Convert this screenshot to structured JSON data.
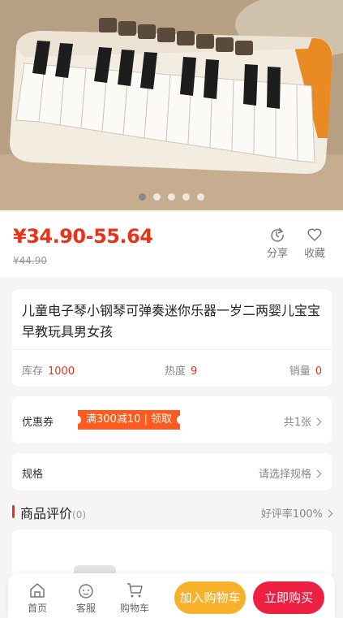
{
  "gallery": {
    "slides": 5,
    "active_slide": 1
  },
  "price": {
    "range": "¥34.90-55.64",
    "original": "¥44.90"
  },
  "actions": {
    "share": "分享",
    "favorite": "收藏"
  },
  "product": {
    "title": "儿童电子琴小钢琴可弹奏迷你乐器一岁二两婴儿宝宝早教玩具男女孩",
    "stock_label": "库存",
    "stock_value": "1000",
    "hot_label": "热度",
    "hot_value": "9",
    "sales_label": "销量",
    "sales_value": "0"
  },
  "coupon": {
    "label": "优惠券",
    "tag": "满300减10 | 领取",
    "count": "共1张"
  },
  "spec": {
    "label": "规格",
    "action": "请选择规格"
  },
  "reviews": {
    "title": "商品评价",
    "count": "(0)",
    "rate": "好评率100%"
  },
  "bottom": {
    "home": "首页",
    "service": "客服",
    "cart": "购物车",
    "add_to_cart": "加入购物车",
    "buy_now": "立即购买"
  },
  "colors": {
    "accent": "#e8331a",
    "cart_button": "#f7b12a",
    "buy_button": "#ee2041",
    "coupon": "#ff5a1f"
  }
}
